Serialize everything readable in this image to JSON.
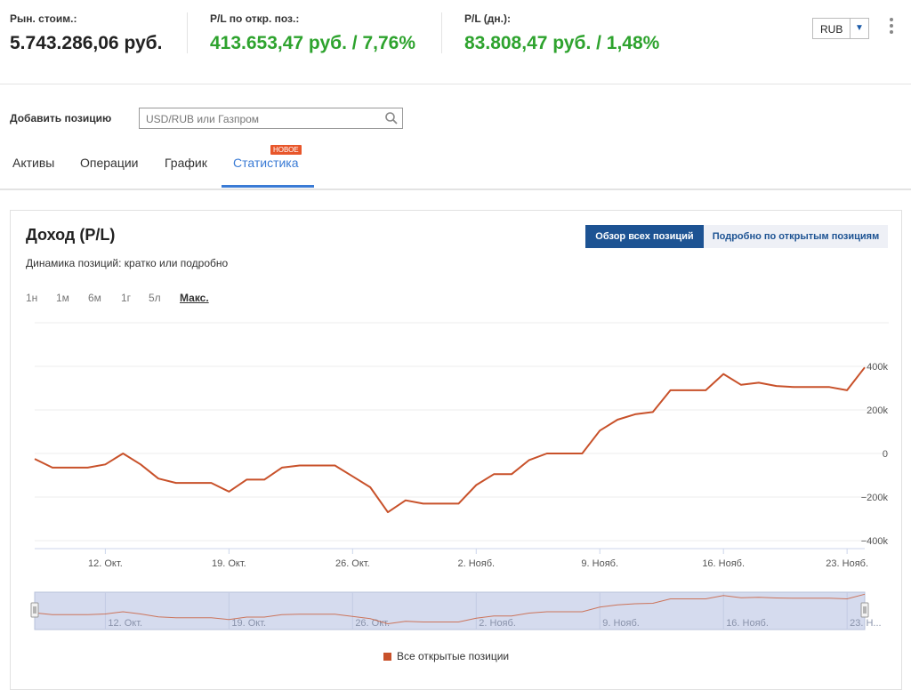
{
  "header": {
    "market_value_label": "Рын. стоим.:",
    "market_value": "5.743.286,06 руб.",
    "pl_open_label": "P/L по откр. поз.:",
    "pl_open": "413.653,47 руб. / 7,76%",
    "pl_day_label": "P/L (дн.):",
    "pl_day": "83.808,47 руб. / 1,48%",
    "currency": "RUB",
    "positive_color": "#2ea32e"
  },
  "add_position": {
    "label": "Добавить позицию",
    "placeholder": "USD/RUB или Газпром"
  },
  "tabs": [
    {
      "label": "Активы",
      "active": false
    },
    {
      "label": "Операции",
      "active": false
    },
    {
      "label": "График",
      "active": false
    },
    {
      "label": "Статистика",
      "active": true,
      "badge": "НОВОЕ"
    }
  ],
  "panel": {
    "title": "Доход (P/L)",
    "subtitle": "Динамика позиций: кратко или подробно",
    "btn_overview": "Обзор всех позиций",
    "btn_detail": "Подробно по открытым позициям",
    "ranges": [
      "1н",
      "1м",
      "6м",
      "1г",
      "5л",
      "Макс."
    ],
    "selected_range": "Макс."
  },
  "chart_data": {
    "type": "line",
    "x_labels": [
      "12. Окт.",
      "19. Окт.",
      "26. Окт.",
      "2. Нояб.",
      "9. Нояб.",
      "16. Нояб.",
      "23. Нояб."
    ],
    "navigator_labels": [
      "12. Окт.",
      "19. Окт.",
      "26. Окт.",
      "2. Нояб.",
      "9. Нояб.",
      "16. Нояб.",
      "23. Н..."
    ],
    "y_ticks": [
      "400k",
      "200k",
      "0",
      "−200k",
      "−400k"
    ],
    "ylim": [
      -400000,
      400000
    ],
    "series": [
      {
        "name": "Все открытые позиции",
        "color": "#c8512a",
        "x": [
          "2018-10-08",
          "2018-10-09",
          "2018-10-10",
          "2018-10-11",
          "2018-10-12",
          "2018-10-13",
          "2018-10-14",
          "2018-10-15",
          "2018-10-16",
          "2018-10-17",
          "2018-10-18",
          "2018-10-19",
          "2018-10-20",
          "2018-10-21",
          "2018-10-22",
          "2018-10-23",
          "2018-10-24",
          "2018-10-25",
          "2018-10-26",
          "2018-10-27",
          "2018-10-28",
          "2018-10-29",
          "2018-10-30",
          "2018-10-31",
          "2018-11-01",
          "2018-11-02",
          "2018-11-03",
          "2018-11-04",
          "2018-11-05",
          "2018-11-06",
          "2018-11-07",
          "2018-11-08",
          "2018-11-09",
          "2018-11-10",
          "2018-11-11",
          "2018-11-12",
          "2018-11-13",
          "2018-11-14",
          "2018-11-15",
          "2018-11-16",
          "2018-11-17",
          "2018-11-18",
          "2018-11-19",
          "2018-11-20",
          "2018-11-21",
          "2018-11-22",
          "2018-11-23",
          "2018-11-24"
        ],
        "values": [
          -25000,
          -65000,
          -65000,
          -65000,
          -50000,
          0,
          -50000,
          -115000,
          -135000,
          -135000,
          -135000,
          -175000,
          -120000,
          -120000,
          -65000,
          -55000,
          -55000,
          -55000,
          -105000,
          -155000,
          -270000,
          -215000,
          -230000,
          -230000,
          -230000,
          -145000,
          -95000,
          -95000,
          -30000,
          0,
          0,
          0,
          105000,
          155000,
          180000,
          190000,
          290000,
          290000,
          290000,
          365000,
          315000,
          325000,
          310000,
          305000,
          305000,
          305000,
          290000,
          395000
        ]
      }
    ],
    "grid": true,
    "legend_position": "bottom-center"
  }
}
